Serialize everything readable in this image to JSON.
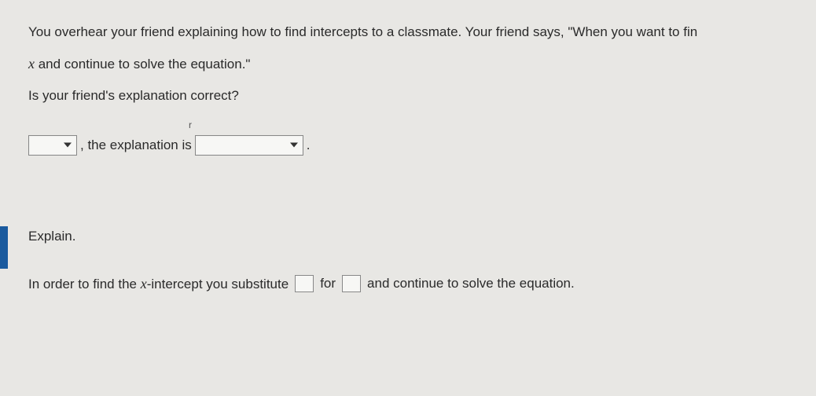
{
  "question": {
    "line1": "You overhear your friend explaining how to find intercepts to a classmate. Your friend says, \"When you want to fin",
    "line2_prefix": "x",
    "line2_rest": " and continue to solve the equation.\"",
    "prompt": "Is your friend's explanation correct?"
  },
  "answer_row": {
    "comma_text": ", the explanation is",
    "period": "."
  },
  "explain": {
    "label": "Explain.",
    "sentence_pre": "In order to find the ",
    "x_var": "x",
    "sentence_mid1": "-intercept you substitute",
    "sentence_mid2": "for",
    "sentence_post": "and continue to solve the equation."
  },
  "stray_mark": "r"
}
